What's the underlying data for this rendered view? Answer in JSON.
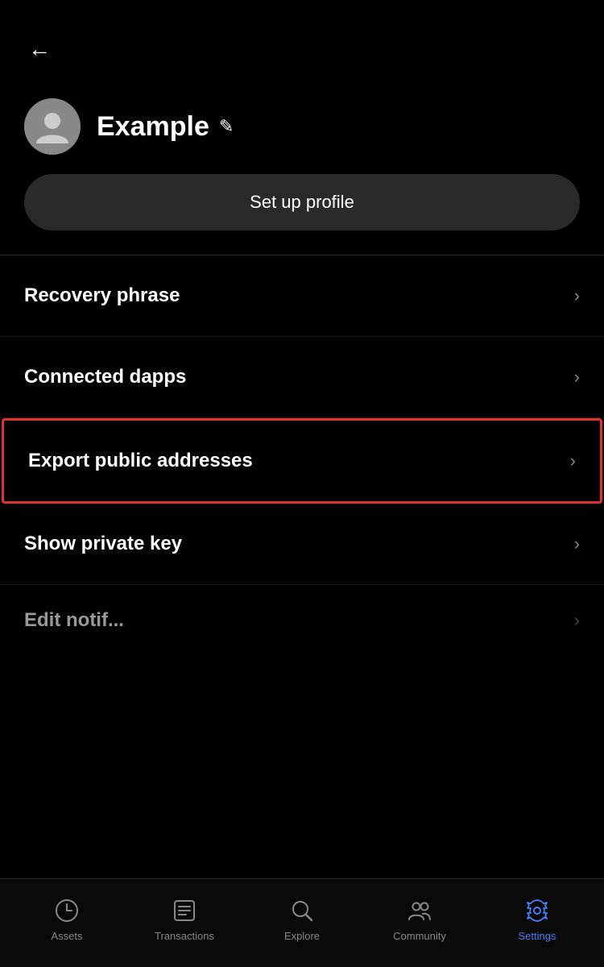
{
  "header": {
    "back_label": "←"
  },
  "profile": {
    "name": "Example",
    "setup_button_label": "Set up profile",
    "edit_icon": "✎"
  },
  "menu": {
    "items": [
      {
        "id": "recovery-phrase",
        "label": "Recovery phrase",
        "highlighted": false
      },
      {
        "id": "connected-dapps",
        "label": "Connected dapps",
        "highlighted": false
      },
      {
        "id": "export-public-addresses",
        "label": "Export public addresses",
        "highlighted": true
      },
      {
        "id": "show-private-key",
        "label": "Show private key",
        "highlighted": false
      },
      {
        "id": "partial-item",
        "label": "Edit notif...",
        "highlighted": false
      }
    ]
  },
  "bottom_nav": {
    "items": [
      {
        "id": "assets",
        "label": "Assets",
        "active": false
      },
      {
        "id": "transactions",
        "label": "Transactions",
        "active": false
      },
      {
        "id": "explore",
        "label": "Explore",
        "active": false
      },
      {
        "id": "community",
        "label": "Community",
        "active": false
      },
      {
        "id": "settings",
        "label": "Settings",
        "active": true
      }
    ]
  }
}
